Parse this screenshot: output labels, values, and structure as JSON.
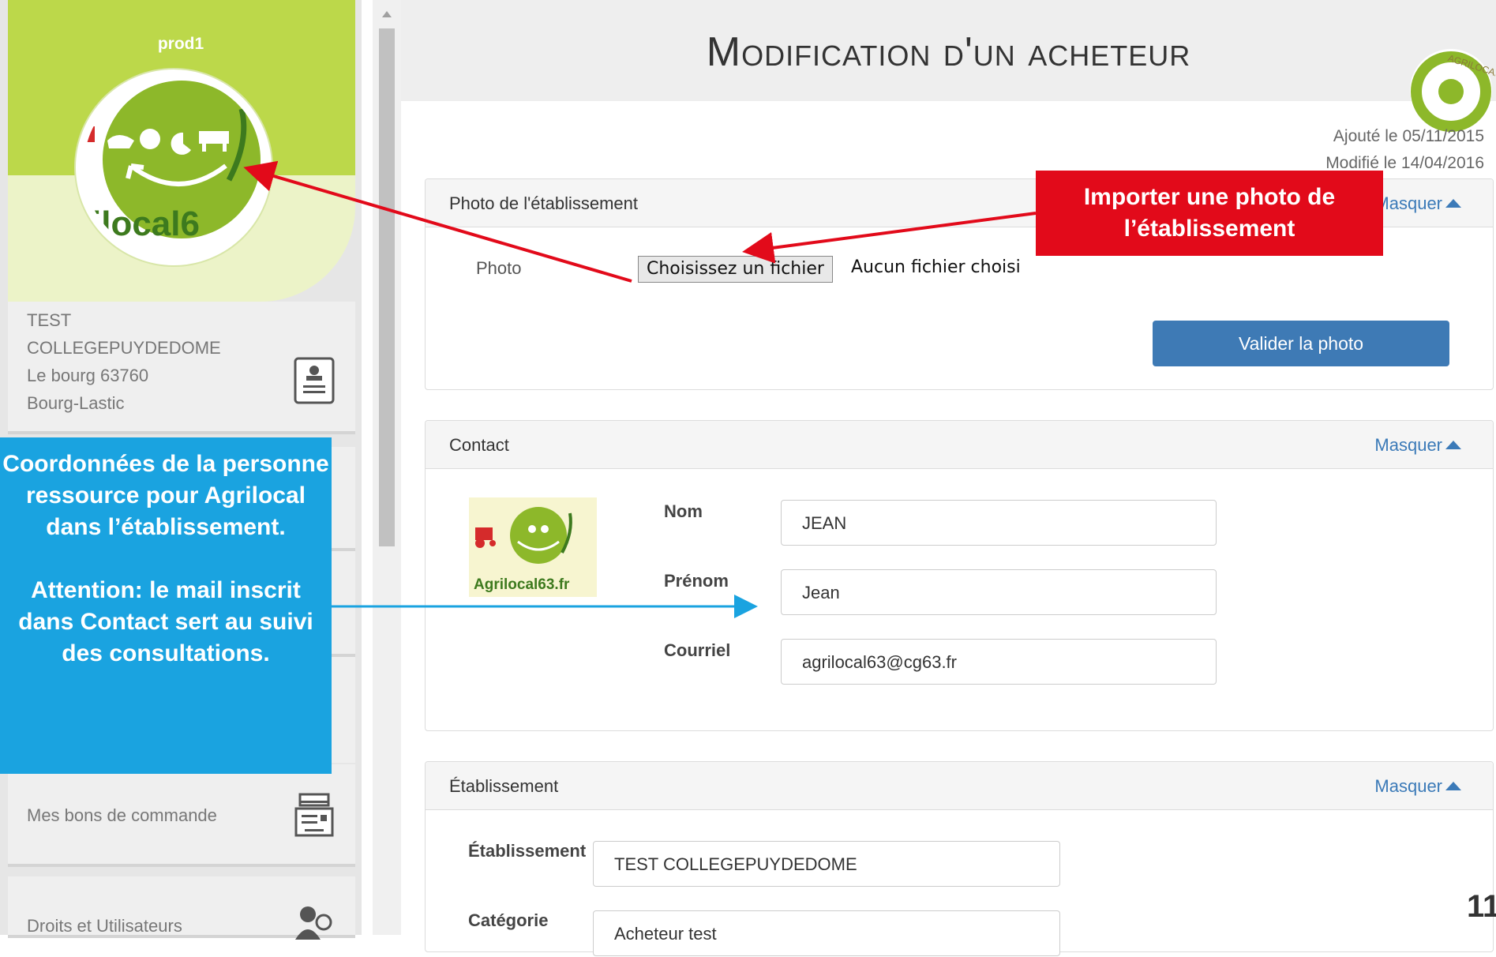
{
  "sidebar": {
    "user": "prod1",
    "avatar_logo_text": "ilocal6",
    "buyer": {
      "line1": "TEST",
      "line2": "COLLEGEPUYDEDOME",
      "line3": "Le bourg 63760",
      "line4": "Bourg-Lastic"
    },
    "orders_label": "Mes bons de commande",
    "rights_label": "Droits et Utilisateurs"
  },
  "main": {
    "title": "Modification d'un acheteur",
    "corner_logo_text": "AGRILOCAL",
    "added": "Ajouté le 05/11/2015",
    "modified": "Modifié le 14/04/2016",
    "photo_panel": {
      "title": "Photo de l'établissement",
      "toggle": "Masquer",
      "photo_label": "Photo",
      "file_button": "Choisissez un fichier",
      "file_status": "Aucun fichier choisi",
      "submit": "Valider la photo"
    },
    "contact_panel": {
      "title": "Contact",
      "toggle": "Masquer",
      "logo_text": "Agrilocal63.fr",
      "nom_label": "Nom",
      "nom_value": "JEAN",
      "prenom_label": "Prénom",
      "prenom_value": "Jean",
      "courriel_label": "Courriel",
      "courriel_value": "agrilocal63@cg63.fr"
    },
    "etab_panel": {
      "title": "Établissement",
      "toggle": "Masquer",
      "etab_label": "Établissement",
      "etab_value": "TEST COLLEGEPUYDEDOME",
      "cat_label": "Catégorie",
      "cat_value": "Acheteur test"
    }
  },
  "callouts": {
    "red": "Importer une photo de l’établissement",
    "blue_p1": "Coordonnées de la personne ressource pour Agrilocal dans l’établissement.",
    "blue_p2": "Attention: le mail inscrit dans Contact sert au suivi des consultations."
  },
  "page_number": "11",
  "colors": {
    "brand_green": "#8db82a",
    "callout_red": "#e20a1a",
    "callout_blue": "#1aa3e0",
    "button_blue": "#3e7ab5"
  },
  "icons": [
    "id-card-icon",
    "inbox-tray-icon",
    "users-icon",
    "chevron-up-icon"
  ]
}
